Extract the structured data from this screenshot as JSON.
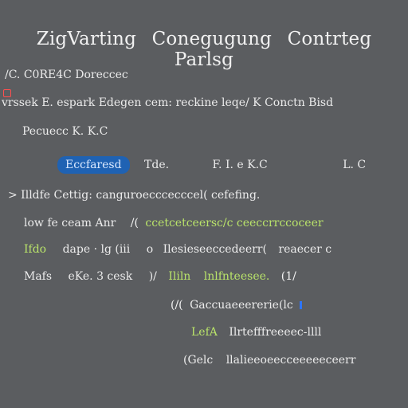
{
  "header": {
    "title_parts": [
      "ZigVarting",
      "Conegugung",
      "Contrteg",
      "Parlsg"
    ]
  },
  "lines": {
    "l1": "/C. C0RE4C   Doreccec",
    "l2": "vrssek   E. espark   Edegen cem:   reckine   leqe/   K Conctn Bisd",
    "l3": "Pecuecc   K.   K.C",
    "l4a": "Eccfaresd",
    "l4b": "Tde.",
    "l4c": "F. I. e K.C",
    "l4d": "L. C",
    "l5": "> Illdfe Cettig:   canguroecccecccel(   cefefing.",
    "l6a": "low   fe   ceam   Anr",
    "l6b": "/(",
    "l6c": "ccetcetceersc/c",
    "l6d": "ceeccrrccoceer",
    "l7a": "Ifdo",
    "l7b": "dape   · lg   (iii",
    "l7c": "o",
    "l7d": "Ilesieseeccedeerr(",
    "l7e": "reaecer   c",
    "l8a": "Mafs",
    "l8b": "eKe. 3 cesk",
    "l8c": ")/",
    "l8d": "Ililn",
    "l8e": "lnlfnteesee.",
    "l8f": "(1/",
    "l9a": "(/(",
    "l9b": "Gaccuaeeererie(lc",
    "l10a": "LefA",
    "l10b": "Ilrtefffreeeec-llll",
    "l11a": "(Gelc",
    "l11b": "llalieeoeecceeeeeceerr"
  }
}
